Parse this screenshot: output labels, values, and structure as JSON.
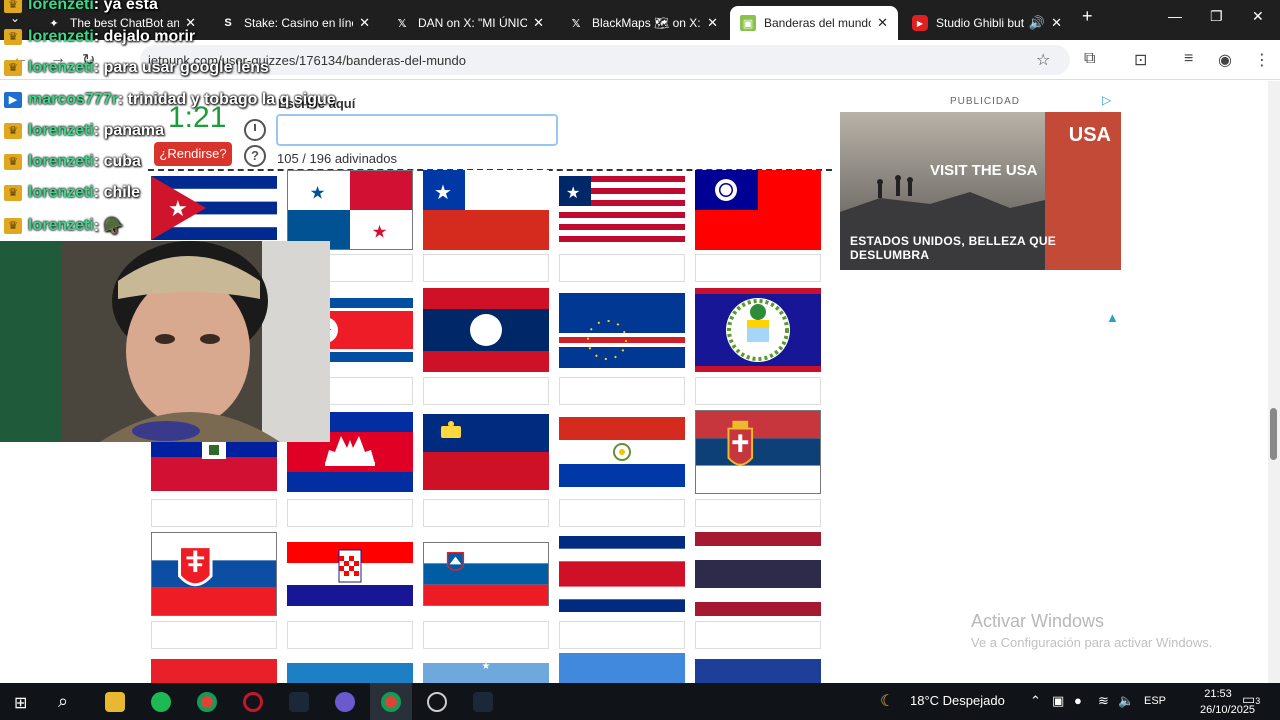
{
  "browser": {
    "tabs": [
      {
        "title": "The best ChatBot and",
        "icon": "chatbot-icon"
      },
      {
        "title": "Stake: Casino en línea",
        "icon": "stake-icon"
      },
      {
        "title": "DAN on X: \"MI ÚNICO",
        "icon": "x-icon"
      },
      {
        "title": "BlackMaps 🗺 on X:",
        "icon": "x-icon"
      },
      {
        "title": "Banderas del mundo",
        "icon": "jetpunk-icon"
      },
      {
        "title": "Studio Ghibli but",
        "icon": "youtube-icon"
      }
    ],
    "url": "jetpunk.com/user-quizzes/176134/banderas-del-mundo"
  },
  "quiz": {
    "timer": "1:21",
    "give_up": "¿Rendirse?",
    "hint": "Escribe aquí",
    "answer_value": "",
    "progress": "105 / 196 adivinados",
    "flags": [
      [
        "cuba",
        "panama",
        "chile",
        "liberia",
        "taiwan"
      ],
      [
        "",
        "north-korea",
        "laos",
        "cape-verde",
        "belize"
      ],
      [
        "haiti",
        "cambodia",
        "liechtenstein",
        "paraguay",
        "serbia"
      ],
      [
        "slovakia",
        "croatia",
        "slovenia",
        "costa-rica",
        "thailand"
      ],
      [
        "red",
        "blue-white",
        "light-blue-star",
        "somalia",
        "blue"
      ]
    ]
  },
  "ad": {
    "label": "PUBLICIDAD",
    "caption": "ESTADOS UNIDOS, BELLEZA QUE DESLUMBRA",
    "brand": "USA",
    "inner": "VISIT THE USA"
  },
  "watermark": {
    "title": "Activar Windows",
    "subtitle": "Ve a Configuración para activar Windows."
  },
  "chat": [
    {
      "user": "lorenzeti",
      "text": ": ya esta",
      "badge": "gold"
    },
    {
      "user": "lorenzeti",
      "text": ": dejalo morir",
      "badge": "gold"
    },
    {
      "user": "lorenzeti",
      "text": ": para usar google lens",
      "badge": "gold"
    },
    {
      "user": "marcos777r",
      "text": ": trinidad y tobago la q sigue",
      "badge": "blue"
    },
    {
      "user": "lorenzeti",
      "text": ": panama",
      "badge": "gold"
    },
    {
      "user": "lorenzeti",
      "text": ": cuba",
      "badge": "gold"
    },
    {
      "user": "lorenzeti",
      "text": ": chile",
      "badge": "gold"
    },
    {
      "user": "lorenzeti",
      "text": ": 🪖",
      "badge": "gold"
    }
  ],
  "taskbar": {
    "weather": "18°C  Despejado",
    "lang": "ESP",
    "time": "21:53",
    "date": "26/10/2025",
    "notifications": "3"
  }
}
